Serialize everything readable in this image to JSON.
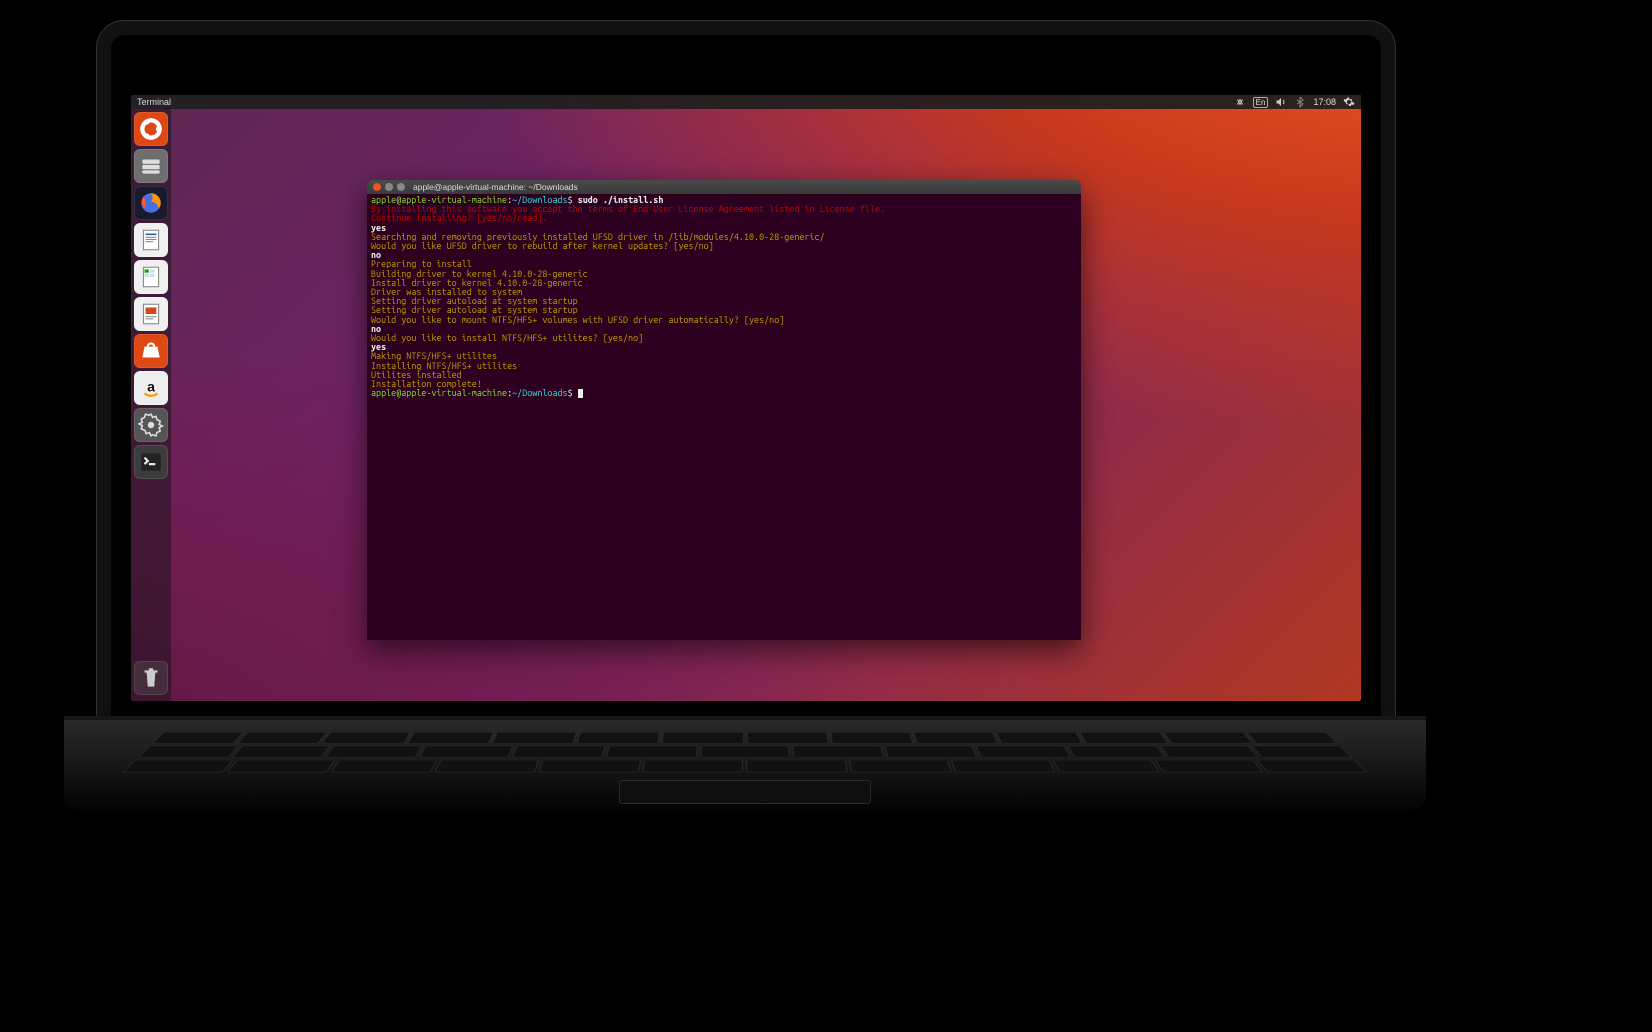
{
  "panel": {
    "app_title": "Terminal",
    "indicators": {
      "lang": "En",
      "time": "17:08"
    }
  },
  "launcher_icons": [
    "ubuntu-dash-icon",
    "files-icon",
    "firefox-icon",
    "writer-icon",
    "calc-icon",
    "impress-icon",
    "software-center-icon",
    "amazon-icon",
    "settings-icon",
    "terminal-icon"
  ],
  "terminal": {
    "title": "apple@apple-virtual-machine: ~/Downloads",
    "prompt": {
      "user_host": "apple@apple-virtual-machine",
      "colon": ":",
      "path": "~/Downloads",
      "dollar": "$ "
    },
    "command": "sudo ./install.sh",
    "lines": [
      {
        "cls": "c-red",
        "text": "By installing this software you accept the terms of End User License Agreement listed in License file."
      },
      {
        "cls": "c-red",
        "text": "Continue installing? [yes/no/read]."
      },
      {
        "cls": "c-white",
        "text": "yes"
      },
      {
        "cls": "c-yellow",
        "text": "Searching and removing previously installed UFSD driver in /lib/modules/4.10.0-28-generic/"
      },
      {
        "cls": "c-yellow",
        "text": "Would you like UFSD driver to rebuild after kernel updates? [yes/no]"
      },
      {
        "cls": "c-white",
        "text": "no"
      },
      {
        "cls": "c-yellow",
        "text": "Preparing to install"
      },
      {
        "cls": "c-yellow",
        "text": "Building driver to kernel 4.10.0-28-generic"
      },
      {
        "cls": "c-yellow",
        "text": "Install driver to kernel 4.10.0-28-generic"
      },
      {
        "cls": "c-yellow",
        "text": "Driver was installed to system"
      },
      {
        "cls": "c-yellow",
        "text": "Setting driver autoload at system startup"
      },
      {
        "cls": "c-yellow",
        "text": "Setting driver autoload at system startup"
      },
      {
        "cls": "c-yellow",
        "text": "Would you like to mount NTFS/HFS+ volumes with UFSD driver automatically? [yes/no]"
      },
      {
        "cls": "c-white",
        "text": "no"
      },
      {
        "cls": "c-yellow",
        "text": "Would you like to install NTFS/HFS+ utilites? [yes/no]"
      },
      {
        "cls": "c-white",
        "text": "yes"
      },
      {
        "cls": "c-yellow",
        "text": "Making NTFS/HFS+ utilites"
      },
      {
        "cls": "c-yellow",
        "text": "Installing NTFS/HFS+ utilites"
      },
      {
        "cls": "c-yellow",
        "text": "Utilites installed"
      },
      {
        "cls": "c-yellow",
        "text": "Installation complete!"
      }
    ]
  }
}
